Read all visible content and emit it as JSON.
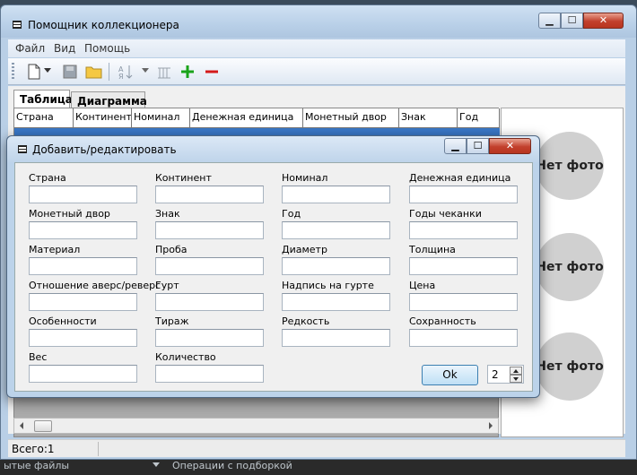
{
  "background": {
    "left_text": "ытые файлы",
    "right_text": "Операции с подборкой"
  },
  "window": {
    "title": "Помощник коллекционера",
    "minimize": "▁",
    "maximize": "☐",
    "close": "✕"
  },
  "menu": [
    "Файл",
    "Вид",
    "Помощь"
  ],
  "toolbar": {
    "icons": [
      "new-document-icon",
      "dropdown-arrow-icon",
      "save-icon",
      "open-folder-icon",
      "sort-icon",
      "filter-icon",
      "add-icon",
      "remove-icon"
    ],
    "add_color": "#1aa31a",
    "remove_color": "#d41a1a"
  },
  "tabs": [
    {
      "label": "Таблица",
      "active": true
    },
    {
      "label": "Диаграмма",
      "active": false
    }
  ],
  "grid": {
    "columns": [
      "Страна",
      "Континент",
      "Номинал",
      "Денежная единица",
      "Монетный двор",
      "Знак",
      "Год"
    ],
    "selection_color": "#3a78c8"
  },
  "photos": [
    "Нет фото",
    "Нет фото",
    "Нет фото"
  ],
  "status": {
    "text": "Всего:1"
  },
  "dialog": {
    "title": "Добавить/редактировать",
    "fields": [
      [
        "Страна",
        "Континент",
        "Номинал",
        "Денежная единица"
      ],
      [
        "Монетный двор",
        "Знак",
        "Год",
        "Годы чеканки"
      ],
      [
        "Материал",
        "Проба",
        "Диаметр",
        "Толщина"
      ],
      [
        "Отношение аверс/реверс",
        "Гурт",
        "Надпись на гурте",
        "Цена"
      ],
      [
        "Особенности",
        "Тираж",
        "Редкость",
        "Сохранность"
      ],
      [
        "Вес",
        "Количество"
      ]
    ],
    "ok_label": "Ok",
    "spinner_value": "2"
  }
}
